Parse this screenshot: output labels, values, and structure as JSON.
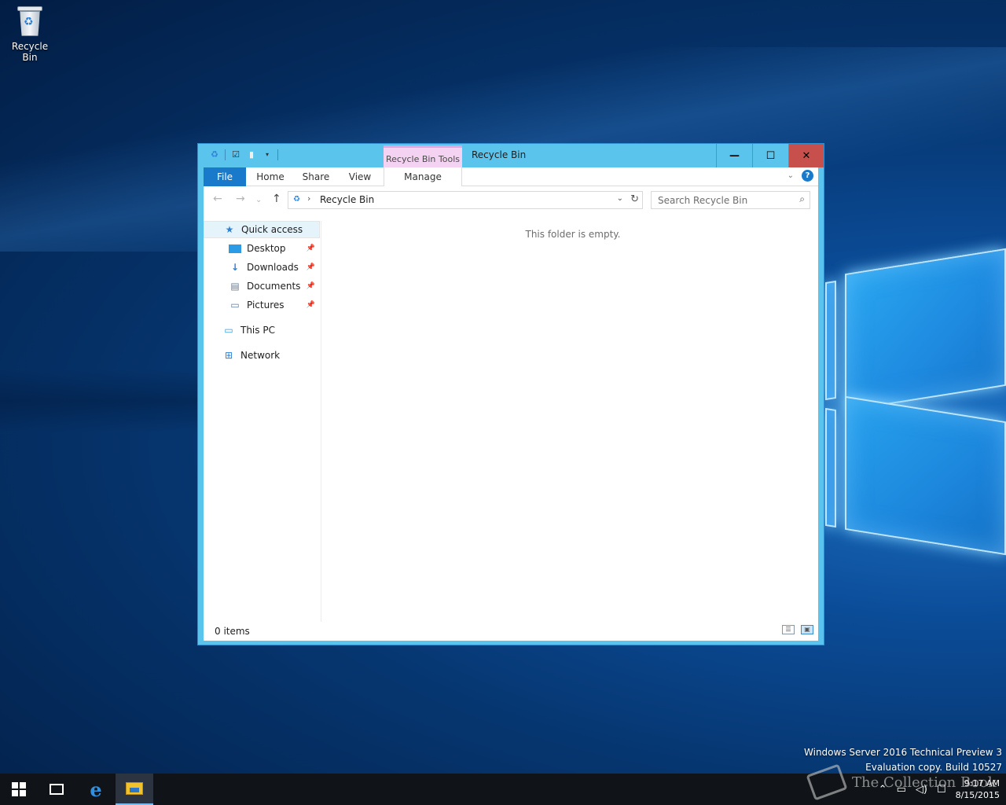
{
  "desktop": {
    "icons": [
      {
        "label": "Recycle Bin",
        "icon": "recycle-bin-icon"
      }
    ],
    "watermark_line1": "Windows Server 2016 Technical Preview 3",
    "watermark_line2": "Evaluation copy. Build 10527",
    "overlay_brand": "The Collection Book"
  },
  "window": {
    "title": "Recycle Bin",
    "context_tab": "Recycle Bin Tools",
    "caption": {
      "minimize": "—",
      "maximize": "☐",
      "close": "✕"
    },
    "ribbon_tabs": [
      "File",
      "Home",
      "Share",
      "View",
      "Manage"
    ],
    "address": {
      "path": "Recycle Bin"
    },
    "search": {
      "placeholder": "Search Recycle Bin"
    },
    "nav_pane": {
      "quick_access": "Quick access",
      "pinned": [
        {
          "label": "Desktop",
          "icon": "desktop-icon"
        },
        {
          "label": "Downloads",
          "icon": "downloads-icon"
        },
        {
          "label": "Documents",
          "icon": "documents-icon"
        },
        {
          "label": "Pictures",
          "icon": "pictures-icon"
        }
      ],
      "this_pc": "This PC",
      "network": "Network"
    },
    "content": {
      "empty_message": "This folder is empty."
    },
    "status": {
      "item_count": "0 items"
    }
  },
  "taskbar": {
    "clock_time": "9:17 AM",
    "clock_date": "8/15/2015"
  },
  "colors": {
    "titlebar": "#5bc4ec",
    "context_tab": "#f4d2f1",
    "file_tab": "#1979ca",
    "close_button": "#c7504c"
  }
}
